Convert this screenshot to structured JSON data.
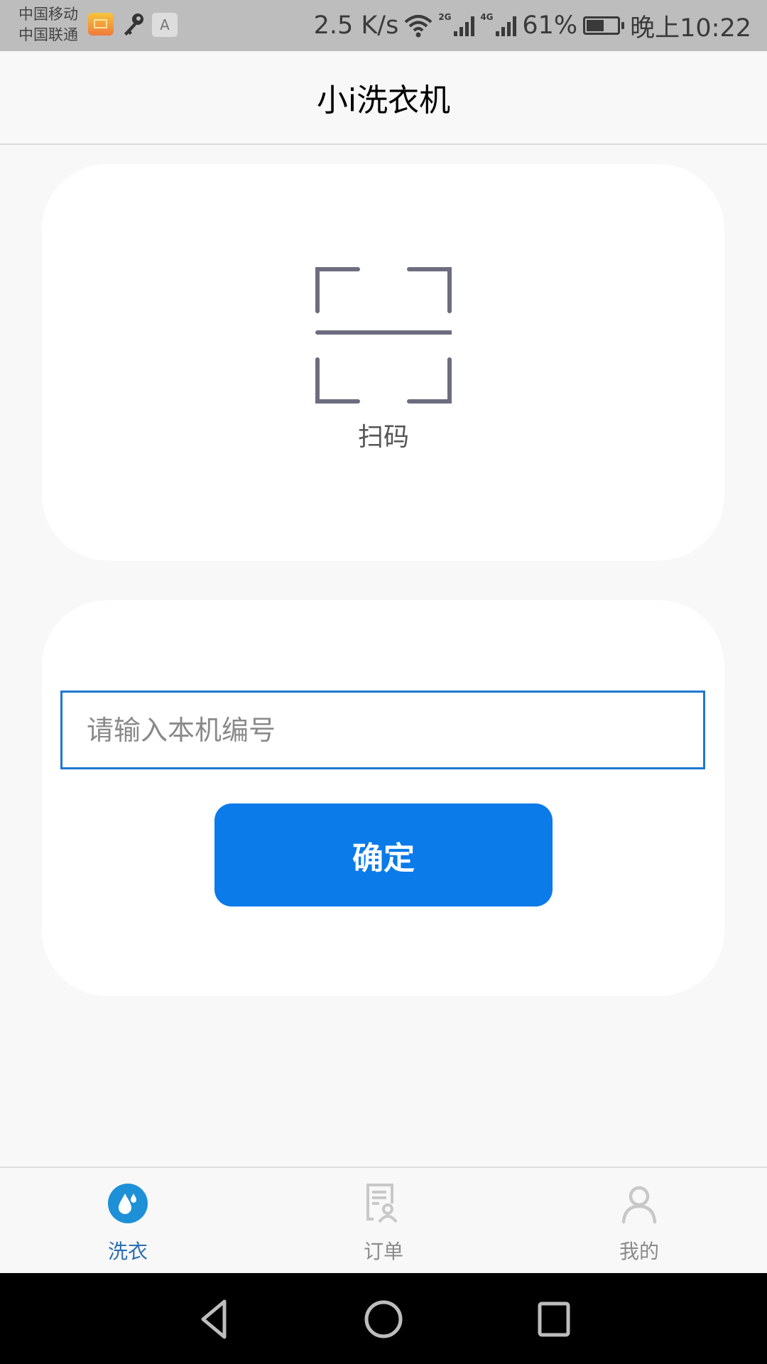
{
  "status_bar": {
    "carrier_1": "中国移动",
    "carrier_2": "中国联通",
    "notification_icons": [
      "mail-icon",
      "key-icon",
      "keyboard-a-icon"
    ],
    "a_icon_label": "A",
    "net_speed": "2.5 K/s",
    "wifi_icon": "wifi-icon",
    "signal_1_label": "2G",
    "signal_2_label": "4G",
    "battery_percent": "61%",
    "battery_level": 0.61,
    "time": "晚上10:22"
  },
  "header": {
    "title": "小i洗衣机"
  },
  "scan_card": {
    "icon": "scan-qr-icon",
    "label": "扫码"
  },
  "input_card": {
    "machine_number_value": "",
    "machine_number_placeholder": "请输入本机编号",
    "confirm_label": "确定"
  },
  "tabbar": {
    "tabs": [
      {
        "label": "洗衣",
        "icon": "water-drop-icon",
        "active": true
      },
      {
        "label": "订单",
        "icon": "order-document-icon",
        "active": false
      },
      {
        "label": "我的",
        "icon": "user-profile-icon",
        "active": false
      }
    ]
  },
  "colors": {
    "accent": "#0a7be8",
    "input_border": "#1e78d0",
    "tab_active_icon": "#1e90d8",
    "tab_active_label": "#2a6fb3",
    "tab_inactive": "#c8c8c8",
    "status_bar_bg": "#bdbdbd"
  },
  "nav_bar": {
    "buttons": [
      "back-icon",
      "home-icon",
      "recents-icon"
    ]
  }
}
